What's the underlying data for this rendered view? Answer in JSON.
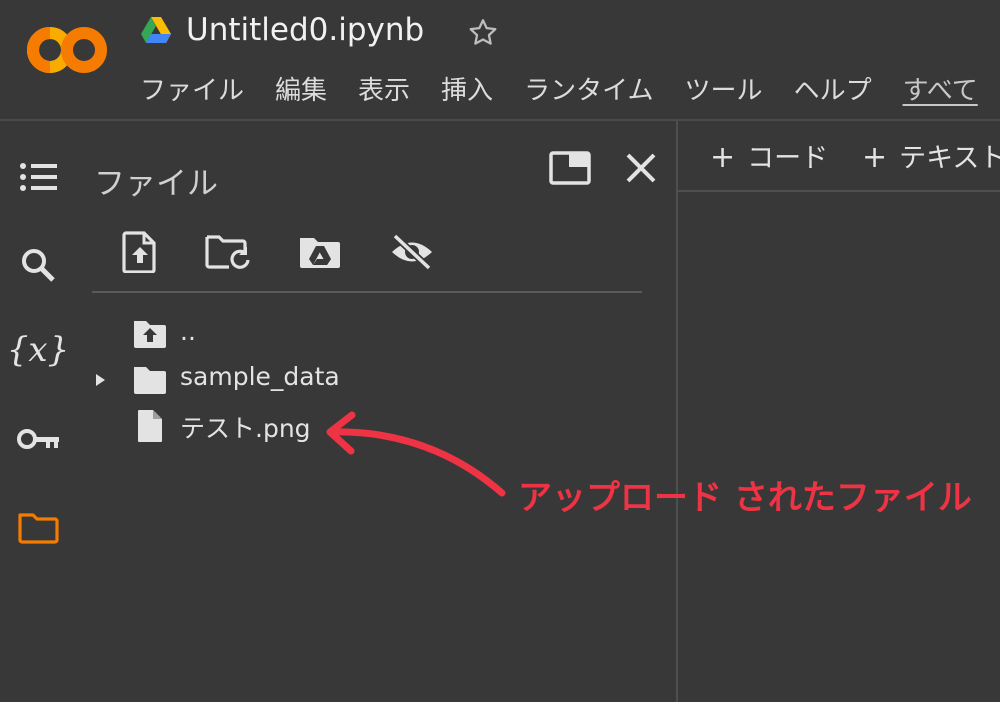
{
  "header": {
    "title": "Untitled0.ipynb",
    "logo_text": "CO",
    "menu": [
      "ファイル",
      "編集",
      "表示",
      "挿入",
      "ランタイム",
      "ツール",
      "ヘルプ",
      "すべて"
    ]
  },
  "rail": {
    "items": [
      "toc-icon",
      "search-icon",
      "variables-icon",
      "key-icon",
      "folder-icon"
    ],
    "variables_label": "{x}",
    "active_color": "#f57c00"
  },
  "files_panel": {
    "title": "ファイル",
    "toolbar": [
      "upload-file-icon",
      "refresh-folder-icon",
      "mount-drive-icon",
      "hide-files-icon"
    ],
    "tree": [
      {
        "name": "..",
        "kind": "parent"
      },
      {
        "name": "sample_data",
        "kind": "folder",
        "collapsed": true
      },
      {
        "name": "テスト.png",
        "kind": "file"
      }
    ]
  },
  "editor": {
    "add_code": "コード",
    "add_text": "テキスト",
    "plus": "+"
  },
  "annotation": {
    "text": "アップロード されたファイル",
    "color": "#ee3344"
  }
}
